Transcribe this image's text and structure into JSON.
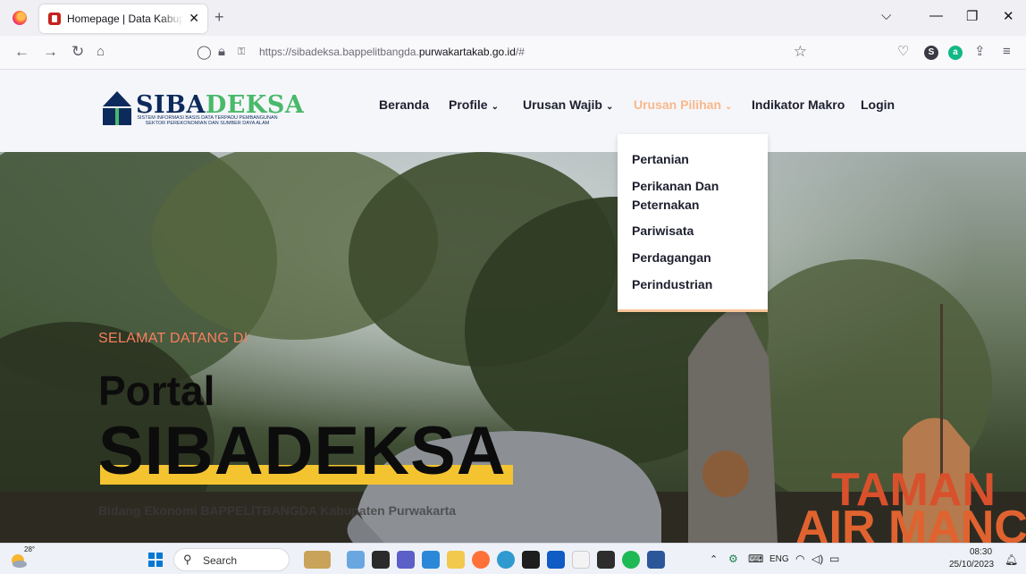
{
  "browser": {
    "tab_title": "Homepage | Data Kabupaten Purwakarta",
    "tab_close": "✕",
    "new_tab": "+",
    "controls": {
      "list": "⌵",
      "minimize": "—",
      "restore": "❐",
      "close": "✕"
    },
    "url_prefix": "https://sibadeksa.bappelitbangda.",
    "url_domain": "purwakartakab.go.id",
    "url_suffix": "/#"
  },
  "site": {
    "logo_name_a": "SIBA",
    "logo_name_b": "DEKSA",
    "logo_subtitle_1": "SISTEM INFORMASI BASIS DATA TERPADU PEMBANGUNAN",
    "logo_subtitle_2": "SEKTOR PEREKONOMIAN DAN SUMBER DAYA ALAM",
    "nav": {
      "home": "Beranda",
      "profile": "Profile",
      "wajib": "Urusan Wajib",
      "pilihan": "Urusan Pilihan",
      "makro": "Indikator Makro",
      "login": "Login"
    },
    "dropdown": [
      "Pertanian",
      "Perikanan Dan Peternakan",
      "Pariwisata",
      "Perdagangan",
      "Perindustrian"
    ]
  },
  "hero": {
    "welcome": "SELAMAT DATANG DI",
    "title_line1": "Portal",
    "title_line2": "SIBADEKSA",
    "tagline": "Bidang Ekonomi BAPPELITBANGDA Kabupaten Purwakarta",
    "search_placeholder": ""
  },
  "taskbar": {
    "weather_temp": "28°",
    "search_label": "Search",
    "language": "ENG",
    "time": "08:30",
    "date": "25/10/2023"
  },
  "colors": {
    "accent": "#f4c430",
    "search_button": "#f4b400",
    "welcome_text": "#f97f5e",
    "nav_active": "#f8b88a",
    "logo_navy": "#0d2a5c",
    "logo_green": "#49b96a"
  }
}
